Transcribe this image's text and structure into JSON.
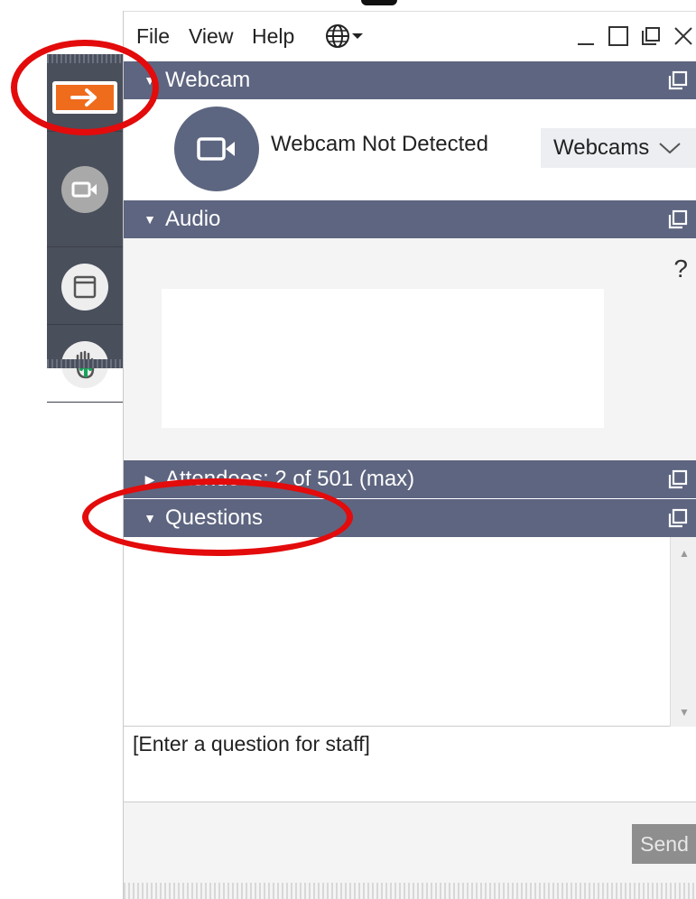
{
  "menubar": {
    "items": [
      "File",
      "View",
      "Help"
    ],
    "language_icon": "globe-icon",
    "window_controls": [
      "minimize-icon",
      "maximize-icon",
      "popout-icon",
      "close-icon"
    ]
  },
  "side_toolbar": {
    "buttons": [
      "show-hide-control-panel-icon",
      "webcam-icon",
      "screen-icon",
      "raise-hand-icon"
    ]
  },
  "panels": {
    "webcam": {
      "title": "Webcam",
      "status": "Webcam Not Detected",
      "select_label": "Webcams"
    },
    "audio": {
      "title": "Audio",
      "help_label": "?"
    },
    "attendees": {
      "title": "Attendees: 2 of 501 (max)"
    },
    "questions": {
      "title": "Questions",
      "input_placeholder": "[Enter a question for staff]",
      "send_label": "Send"
    }
  },
  "colors": {
    "panel_header": "#5e6580",
    "toolbar": "#4a4f5c",
    "accent_orange": "#ef6c1d",
    "annotation_red": "#e30b0b"
  }
}
